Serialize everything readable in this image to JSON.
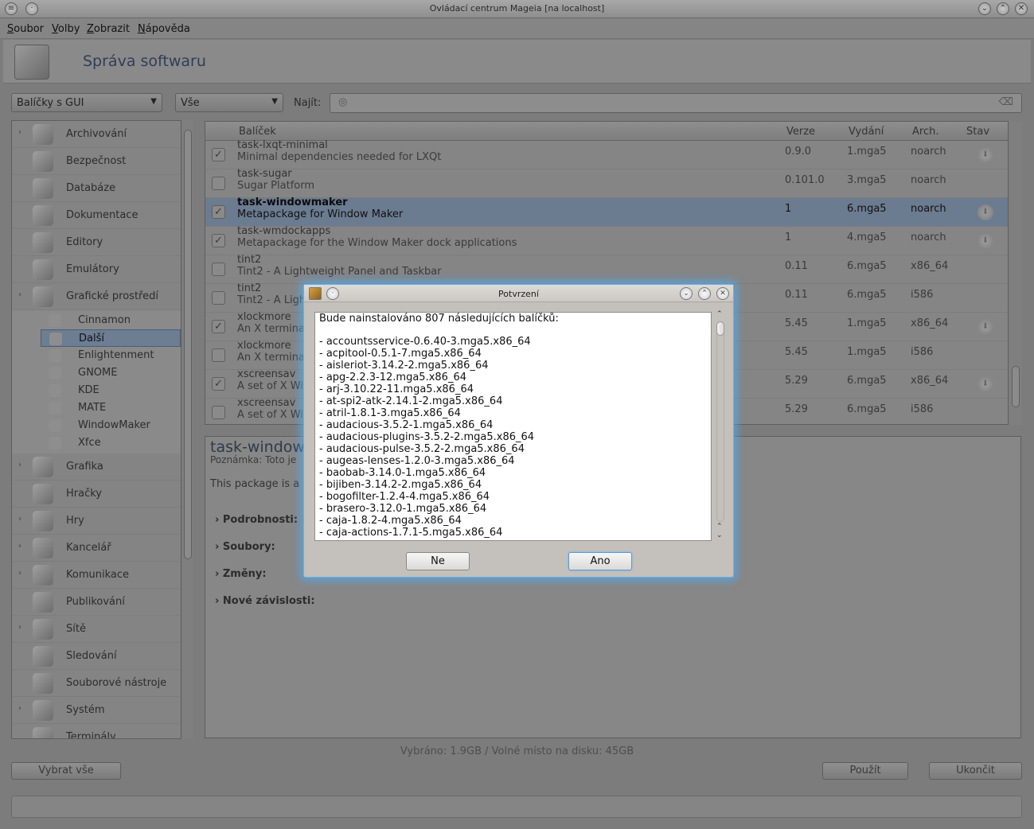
{
  "window": {
    "title": "Ovládací centrum Mageia  [na localhost]"
  },
  "menu": [
    "Soubor",
    "Volby",
    "Zobrazit",
    "Nápověda"
  ],
  "header": {
    "title": "Správa softwaru"
  },
  "toolbar": {
    "filter1": "Balíčky s GUI",
    "filter2": "Vše",
    "find_label": "Najít:"
  },
  "tree": {
    "items": [
      {
        "label": "Archivování",
        "expander": "›"
      },
      {
        "label": "Bezpečnost",
        "expander": ""
      },
      {
        "label": "Databáze",
        "expander": ""
      },
      {
        "label": "Dokumentace",
        "expander": ""
      },
      {
        "label": "Editory",
        "expander": ""
      },
      {
        "label": "Emulátory",
        "expander": ""
      },
      {
        "label": "Grafické prostředí",
        "expander": "›"
      }
    ],
    "subitems": [
      "Cinnamon",
      "Další",
      "Enlightenment",
      "GNOME",
      "KDE",
      "MATE",
      "WindowMaker",
      "Xfce"
    ],
    "items2": [
      {
        "label": "Grafika",
        "expander": "›"
      },
      {
        "label": "Hračky",
        "expander": ""
      },
      {
        "label": "Hry",
        "expander": "›"
      },
      {
        "label": "Kancelář",
        "expander": "›"
      },
      {
        "label": "Komunikace",
        "expander": "›"
      },
      {
        "label": "Publikování",
        "expander": ""
      },
      {
        "label": "Sítě",
        "expander": "›"
      },
      {
        "label": "Sledování",
        "expander": ""
      },
      {
        "label": "Souborové nástroje",
        "expander": ""
      },
      {
        "label": "Systém",
        "expander": "›"
      },
      {
        "label": "Terminály",
        "expander": ""
      }
    ]
  },
  "table": {
    "headers": [
      "Balíček",
      "Verze",
      "Vydání",
      "Arch.",
      "Stav"
    ],
    "rows": [
      {
        "name": "task-lxqt-minimal",
        "desc": "Minimal dependencies needed for LXQt",
        "ver": "0.9.0",
        "rel": "1.mga5",
        "arch": "noarch",
        "checked": "✓"
      },
      {
        "name": "task-sugar",
        "desc": "Sugar Platform",
        "ver": "0.101.0",
        "rel": "3.mga5",
        "arch": "noarch",
        "checked": ""
      },
      {
        "name": "task-windowmaker",
        "desc": "Metapackage for Window Maker",
        "ver": "1",
        "rel": "6.mga5",
        "arch": "noarch",
        "checked": "✓"
      },
      {
        "name": "task-wmdockapps",
        "desc": "Metapackage for the Window Maker dock applications",
        "ver": "1",
        "rel": "4.mga5",
        "arch": "noarch",
        "checked": "✓"
      },
      {
        "name": "tint2",
        "desc": "Tint2 - A Lightweight Panel and Taskbar",
        "ver": "0.11",
        "rel": "6.mga5",
        "arch": "x86_64",
        "checked": ""
      },
      {
        "name": "tint2",
        "desc": "Tint2 - A Ligh",
        "ver": "0.11",
        "rel": "6.mga5",
        "arch": "i586",
        "checked": ""
      },
      {
        "name": "xlockmore",
        "desc": "An X termina",
        "ver": "5.45",
        "rel": "1.mga5",
        "arch": "x86_64",
        "checked": "✓"
      },
      {
        "name": "xlockmore",
        "desc": "An X termina",
        "ver": "5.45",
        "rel": "1.mga5",
        "arch": "i586",
        "checked": ""
      },
      {
        "name": "xscreensav",
        "desc": "A set of X Wi",
        "ver": "5.29",
        "rel": "6.mga5",
        "arch": "x86_64",
        "checked": "✓"
      },
      {
        "name": "xscreensav",
        "desc": "A set of X Wi",
        "ver": "5.29",
        "rel": "6.mga5",
        "arch": "i586",
        "checked": ""
      }
    ]
  },
  "detail": {
    "title": "task-window",
    "note": "Poznámka: Toto je",
    "desc": "This package is a m                                                                                                                    complete Window Maker window manager under mageia.",
    "sections": [
      "› Podrobnosti:",
      "› Soubory:",
      "› Změny:",
      "› Nové závislosti:"
    ]
  },
  "status": "Vybráno: 1.9GB / Volné místo na disku: 45GB",
  "buttons": {
    "select_all": "Vybrat vše",
    "apply": "Použít",
    "quit": "Ukončit"
  },
  "dialog": {
    "title": "Potvrzení",
    "heading": "Bude nainstalováno 807 následujících balíčků:",
    "packages": [
      "- accountsservice-0.6.40-3.mga5.x86_64",
      "- acpitool-0.5.1-7.mga5.x86_64",
      "- aisleriot-3.14.2-2.mga5.x86_64",
      "- apg-2.2.3-12.mga5.x86_64",
      "- arj-3.10.22-11.mga5.x86_64",
      "- at-spi2-atk-2.14.1-2.mga5.x86_64",
      "- atril-1.8.1-3.mga5.x86_64",
      "- audacious-3.5.2-1.mga5.x86_64",
      "- audacious-plugins-3.5.2-2.mga5.x86_64",
      "- audacious-pulse-3.5.2-2.mga5.x86_64",
      "- augeas-lenses-1.2.0-3.mga5.x86_64",
      "- baobab-3.14.0-1.mga5.x86_64",
      "- bijiben-3.14.2-2.mga5.x86_64",
      "- bogofilter-1.2.4-4.mga5.x86_64",
      "- brasero-3.12.0-1.mga5.x86_64",
      "- caja-1.8.2-4.mga5.x86_64",
      "- caja-actions-1.7.1-5.mga5.x86_64"
    ],
    "no": "Ne",
    "yes": "Ano"
  }
}
